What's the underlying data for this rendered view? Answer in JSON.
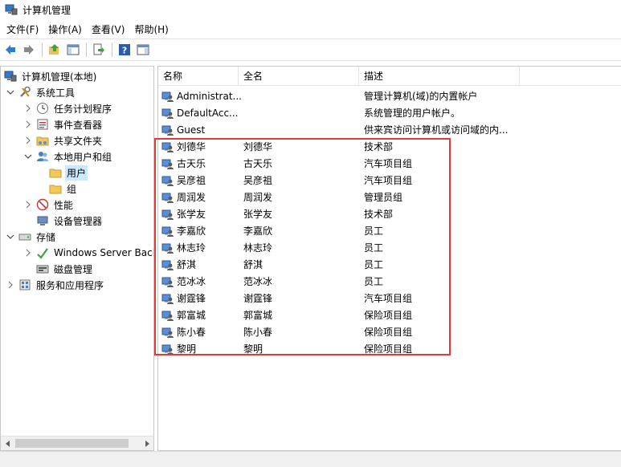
{
  "window": {
    "title": "计算机管理"
  },
  "menu": [
    "文件(F)",
    "操作(A)",
    "查看(V)",
    "帮助(H)"
  ],
  "tree": {
    "root": "计算机管理(本地)",
    "system_tools": "系统工具",
    "task_scheduler": "任务计划程序",
    "event_viewer": "事件查看器",
    "shared_folders": "共享文件夹",
    "local_users_groups": "本地用户和组",
    "users": "用户",
    "groups": "组",
    "performance": "性能",
    "device_manager": "设备管理器",
    "storage": "存储",
    "wsb": "Windows Server Backup",
    "disk_mgmt": "磁盘管理",
    "services_apps": "服务和应用程序"
  },
  "list": {
    "headers": {
      "name": "名称",
      "full": "全名",
      "desc": "描述"
    },
    "rows": [
      {
        "name": "Administrat...",
        "full": "",
        "desc": "管理计算机(域)的内置帐户"
      },
      {
        "name": "DefaultAcc...",
        "full": "",
        "desc": "系统管理的用户帐户。"
      },
      {
        "name": "Guest",
        "full": "",
        "desc": "供来宾访问计算机或访问域的内..."
      },
      {
        "name": "刘德华",
        "full": "刘德华",
        "desc": "技术部"
      },
      {
        "name": "古天乐",
        "full": "古天乐",
        "desc": "汽车项目组"
      },
      {
        "name": "吴彦祖",
        "full": "吴彦祖",
        "desc": "汽车项目组"
      },
      {
        "name": "周润发",
        "full": "周润发",
        "desc": "管理员组"
      },
      {
        "name": "张学友",
        "full": "张学友",
        "desc": "技术部"
      },
      {
        "name": "李嘉欣",
        "full": "李嘉欣",
        "desc": "员工"
      },
      {
        "name": "林志玲",
        "full": "林志玲",
        "desc": "员工"
      },
      {
        "name": "舒淇",
        "full": "舒淇",
        "desc": "员工"
      },
      {
        "name": "范冰冰",
        "full": "范冰冰",
        "desc": "员工"
      },
      {
        "name": "谢霆锋",
        "full": "谢霆锋",
        "desc": "汽车项目组"
      },
      {
        "name": "郭富城",
        "full": "郭富城",
        "desc": "保险项目组"
      },
      {
        "name": "陈小春",
        "full": "陈小春",
        "desc": "保险项目组"
      },
      {
        "name": "黎明",
        "full": "黎明",
        "desc": "保险项目组"
      }
    ]
  },
  "colors": {
    "highlight": "#e53935",
    "selection": "#cce8ff",
    "folder": "#f3c85a"
  }
}
